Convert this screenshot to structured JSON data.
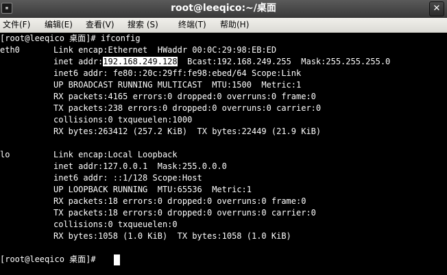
{
  "window": {
    "title": "root@leeqico:~/桌面",
    "close_glyph": "✕",
    "icon_glyph": "▪"
  },
  "menu": [
    "文件(F)",
    "编辑(E)",
    "查看(V)",
    "搜索 (S)",
    "终端(T)",
    "帮助(H)"
  ],
  "terminal": {
    "prompt1": "[root@leeqico 桌面]# ifconfig",
    "eth0_label": "eth0",
    "eth0_link": "Link encap:Ethernet  HWaddr 00:0C:29:98:EB:ED",
    "eth0_inet_prefix": "inet addr:",
    "eth0_inet_ip": "192.168.249.128",
    "eth0_inet_rest": "  Bcast:192.168.249.255  Mask:255.255.255.0",
    "eth0_inet6": "inet6 addr: fe80::20c:29ff:fe98:ebed/64 Scope:Link",
    "eth0_flags": "UP BROADCAST RUNNING MULTICAST  MTU:1500  Metric:1",
    "eth0_rx_packets": "RX packets:4165 errors:0 dropped:0 overruns:0 frame:0",
    "eth0_tx_packets": "TX packets:238 errors:0 dropped:0 overruns:0 carrier:0",
    "eth0_collisions": "collisions:0 txqueuelen:1000",
    "eth0_bytes": "RX bytes:263412 (257.2 KiB)  TX bytes:22449 (21.9 KiB)",
    "lo_label": "lo",
    "lo_link": "Link encap:Local Loopback",
    "lo_inet": "inet addr:127.0.0.1  Mask:255.0.0.0",
    "lo_inet6": "inet6 addr: ::1/128 Scope:Host",
    "lo_flags": "UP LOOPBACK RUNNING  MTU:65536  Metric:1",
    "lo_rx_packets": "RX packets:18 errors:0 dropped:0 overruns:0 frame:0",
    "lo_tx_packets": "TX packets:18 errors:0 dropped:0 overruns:0 carrier:0",
    "lo_collisions": "collisions:0 txqueuelen:0",
    "lo_bytes": "RX bytes:1058 (1.0 KiB)  TX bytes:1058 (1.0 KiB)",
    "prompt2": "[root@leeqico 桌面]# "
  }
}
